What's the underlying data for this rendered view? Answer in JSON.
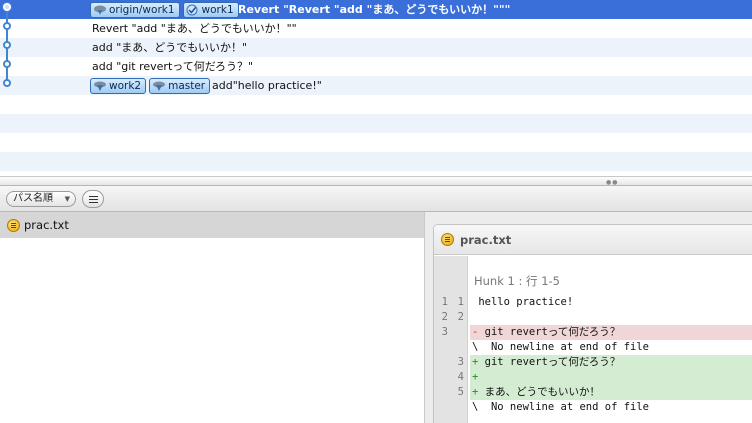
{
  "commits": [
    {
      "refs": [
        {
          "label": "origin/work1",
          "kind": "remote"
        },
        {
          "label": "work1",
          "kind": "head"
        }
      ],
      "message": "Revert \"Revert \"add \"まあ、どうでもいいか！\"\"\"",
      "selected": true
    },
    {
      "refs": [],
      "message": "Revert \"add \"まあ、どうでもいいか！\"\"",
      "selected": false
    },
    {
      "refs": [],
      "message": "add \"まあ、どうでもいいか！\"",
      "selected": false
    },
    {
      "refs": [],
      "message": "add \"git revertって何だろう？\"",
      "selected": false
    },
    {
      "refs": [
        {
          "label": "work2",
          "kind": "branch"
        },
        {
          "label": "master",
          "kind": "branch"
        }
      ],
      "message": "add\"hello practice!\"",
      "selected": false
    }
  ],
  "toolbar": {
    "sort_label": "パス名順",
    "sort_arrow": "▼"
  },
  "files": [
    {
      "name": "prac.txt",
      "status_icon": "modified-icon"
    }
  ],
  "diff": {
    "file_name": "prac.txt",
    "hunk_title": "Hunk 1 : 行 1-5",
    "lines": [
      {
        "kind": "ctx",
        "old": "1",
        "new": "1",
        "text": " hello practice!"
      },
      {
        "kind": "ctx",
        "old": "2",
        "new": "2",
        "text": ""
      },
      {
        "kind": "del",
        "old": "3",
        "new": "",
        "sym": "-",
        "text": " git revertって何だろう？"
      },
      {
        "kind": "note",
        "old": "",
        "new": "",
        "text": "\\  No newline at end of file"
      },
      {
        "kind": "add",
        "old": "",
        "new": "3",
        "sym": "+",
        "text": " git revertって何だろう？"
      },
      {
        "kind": "add",
        "old": "",
        "new": "4",
        "sym": "+",
        "text": ""
      },
      {
        "kind": "add",
        "old": "",
        "new": "5",
        "sym": "+",
        "text": " まあ、どうでもいいか！"
      },
      {
        "kind": "note",
        "old": "",
        "new": "",
        "text": "\\  No newline at end of file"
      }
    ]
  },
  "colors": {
    "selection": "#3a6fd9",
    "graph_line": "#3f86cf",
    "deleted_line_bg": "#f0d6d6",
    "added_line_bg": "#d4ecd2"
  }
}
